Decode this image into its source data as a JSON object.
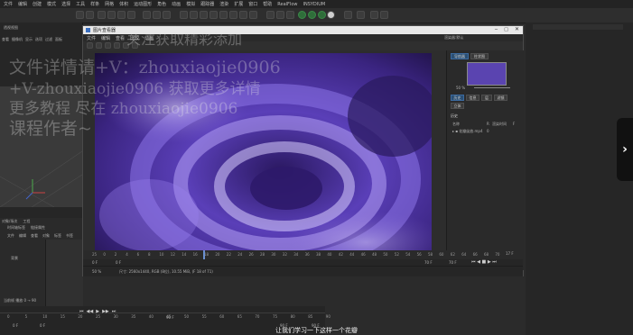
{
  "app": {
    "menu": [
      "文件",
      "编辑",
      "创建",
      "模式",
      "选择",
      "工具",
      "样条",
      "网格",
      "体积",
      "运动图形",
      "角色",
      "动画",
      "模拟",
      "跟踪器",
      "渲染",
      "扩展",
      "窗口",
      "帮助"
    ],
    "menu_extra": [
      "RealFlow",
      "INSYDIUM"
    ],
    "left_tabs": [
      "查看",
      "摄像机",
      "显示",
      "选项",
      "过滤",
      "面板"
    ],
    "left_tab_header": "透视视图",
    "obj_tabs": [
      "对象/场次",
      "工程"
    ],
    "obj_subtabs": [
      "时间轴标签",
      "链接属性"
    ],
    "obj_menu": [
      "文件",
      "编辑",
      "查看",
      "对象",
      "标签",
      "书签"
    ],
    "obj_item": "背景",
    "layer_label": "层",
    "timeline_frames": [
      "0",
      "5",
      "10",
      "15",
      "20",
      "25",
      "30",
      "35",
      "40",
      "45",
      "50",
      "55",
      "60",
      "65",
      "70",
      "75",
      "80",
      "85",
      "90"
    ],
    "timeline_values": {
      "start": "0 F",
      "start2": "0 F",
      "current": "90 F",
      "end": "90 F",
      "end2": "90 F",
      "display": "90 F"
    },
    "bottom_status": "当前帧 播放 0 → 90"
  },
  "picture_viewer": {
    "title": "图片查看器",
    "menu": [
      "文件",
      "编辑",
      "查看",
      "比较",
      "动画"
    ],
    "side_tabs": [
      "导航器",
      "柱状图"
    ],
    "zoom": "50 %",
    "side_buttons": [
      "历史",
      "信息",
      "层",
      "滤镜",
      "立体"
    ],
    "history_header": "历史",
    "history_cols": [
      "名称",
      "R",
      "渲染时间",
      "F"
    ],
    "history_item": "花瓣绽放.mp4",
    "history_item_val": "0",
    "ruler_ticks": [
      "25",
      "0",
      "2",
      "4",
      "6",
      "8",
      "10",
      "12",
      "14",
      "16",
      "18",
      "20",
      "22",
      "24",
      "26",
      "28",
      "30",
      "32",
      "34",
      "36",
      "38",
      "40",
      "42",
      "44",
      "46",
      "48",
      "50",
      "52",
      "54",
      "56",
      "58",
      "60",
      "62",
      "64",
      "66",
      "68",
      "70"
    ],
    "frame_left": "0 F",
    "frame_a": "0 F",
    "frame_b": "70 F",
    "frame_c": "70 F",
    "frame_end": "17 F",
    "status_zoom": "50 %",
    "status_text": "尺寸: 2560x1440, RGB (8位), 10.55 MiB, (F 18 of 71)",
    "render_preset": "渲染器:默认"
  },
  "watermark": {
    "line1": "文件详情请+V：zhouxiaojie0906",
    "line2": "+V-zhouxiaojie0906 获取更多详情",
    "line3": "更多教程  尽在  zhouxiaojie0906",
    "line4": "课程作者~",
    "top": "关注获取精彩添加"
  },
  "subtitle": "让我们学习一下这样一个花瓣",
  "colors": {
    "accent": "#2b4f73",
    "bg": "#2b2b2b",
    "image_main": "#6a4fc8"
  }
}
